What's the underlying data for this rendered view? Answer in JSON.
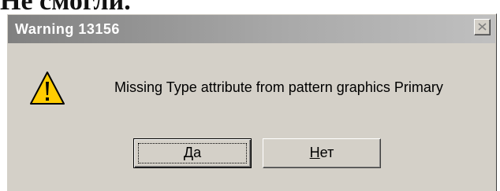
{
  "background_text": "Не смогли.",
  "dialog": {
    "title": "Warning  13156",
    "message": "Missing Type attribute from pattern graphics Primary",
    "icon": "warning-icon",
    "close_icon": "close-icon",
    "buttons": {
      "yes": {
        "mnemonic": "Д",
        "rest": "а"
      },
      "no": {
        "mnemonic": "Н",
        "rest": "ет"
      }
    }
  },
  "colors": {
    "dialog_face": "#d4d0c8",
    "titlebar_inactive_start": "#808080",
    "titlebar_inactive_end": "#c0c0c0",
    "warning_yellow": "#ffcc00"
  }
}
